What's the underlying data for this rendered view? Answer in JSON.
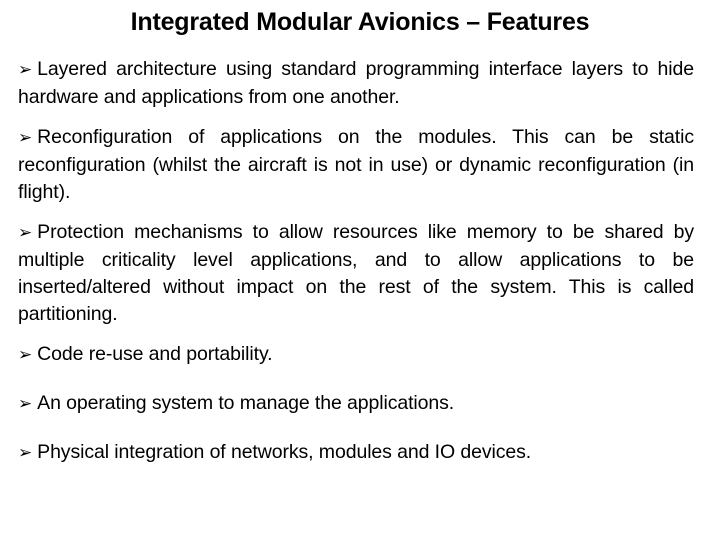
{
  "slide": {
    "title": "Integrated Modular Avionics – Features",
    "bullet_glyph": "➢",
    "bullets": [
      {
        "text": "Layered architecture using standard programming interface layers to hide hardware and applications from one another.",
        "style": "justified"
      },
      {
        "text": "Reconfiguration of applications on the modules. This can be static reconfiguration (whilst the aircraft is not in use) or dynamic reconfiguration (in flight).",
        "style": "justified"
      },
      {
        "text": "Protection mechanisms to allow resources like memory to be shared by multiple criticality level applications, and to allow applications to be inserted/altered without impact on the rest of the system. This is called partitioning.",
        "style": "justified"
      },
      {
        "text": "Code re-use and portability.",
        "style": "short"
      },
      {
        "text": "An operating system to manage the applications.",
        "style": "short"
      },
      {
        "text": "Physical integration of networks, modules and IO devices.",
        "style": "short"
      }
    ]
  },
  "colors": {
    "background": "#ffffff",
    "text": "#000000"
  }
}
